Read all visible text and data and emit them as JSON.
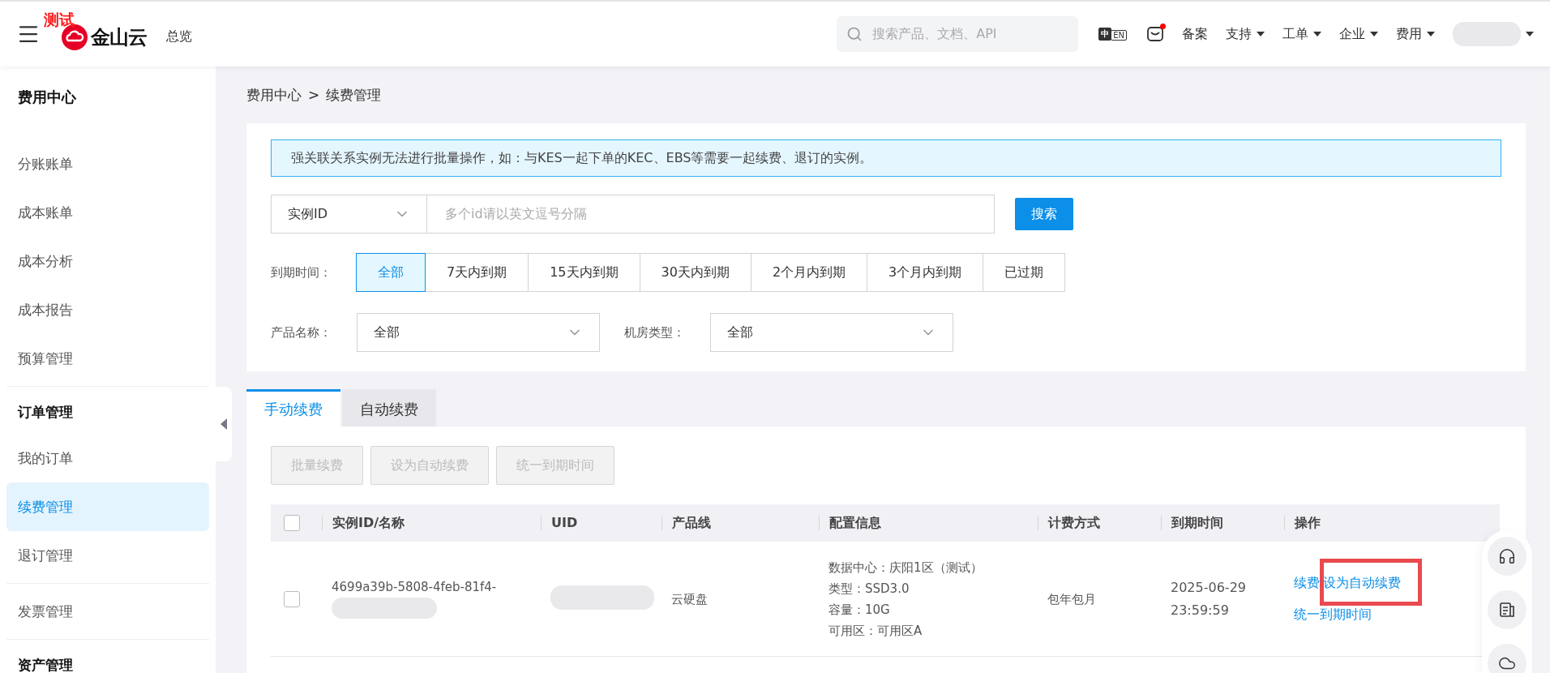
{
  "header": {
    "badge": "测试",
    "logo_text": "金山云",
    "overview": "总览",
    "search": {
      "placeholder": "搜索产品、文档、API"
    },
    "lang_switch": [
      {
        "label": "中",
        "selected": true
      },
      {
        "label": "EN",
        "selected": false
      }
    ],
    "mail": {
      "unread": true
    },
    "nav": [
      {
        "label": "备案",
        "dropdown": false
      },
      {
        "label": "支持",
        "dropdown": true
      },
      {
        "label": "工单",
        "dropdown": true
      },
      {
        "label": "企业",
        "dropdown": true
      },
      {
        "label": "费用",
        "dropdown": true
      }
    ]
  },
  "sidebar": {
    "title": "费用中心",
    "groups": [
      {
        "items": [
          {
            "label": "分账账单",
            "selected": false
          },
          {
            "label": "成本账单",
            "selected": false
          },
          {
            "label": "成本分析",
            "selected": false
          },
          {
            "label": "成本报告",
            "selected": false
          },
          {
            "label": "预算管理",
            "selected": false
          }
        ]
      },
      {
        "heading": "订单管理",
        "items": [
          {
            "label": "我的订单",
            "selected": false
          },
          {
            "label": "续费管理",
            "selected": true
          },
          {
            "label": "退订管理",
            "selected": false
          }
        ]
      },
      {
        "items": [
          {
            "label": "发票管理",
            "selected": false
          }
        ]
      },
      {
        "heading": "资产管理"
      }
    ]
  },
  "breadcrumb": {
    "items": [
      "费用中心",
      "续费管理"
    ],
    "separator": ">"
  },
  "notice": "强关联关系实例无法进行批量操作，如：与KES一起下单的KEC、EBS等需要一起续费、退订的实例。",
  "search": {
    "field": "实例ID",
    "placeholder": "多个id请以英文逗号分隔",
    "button": "搜索"
  },
  "expiry_filter": {
    "label": "到期时间：",
    "options": [
      {
        "label": "全部",
        "selected": true
      },
      {
        "label": "7天内到期",
        "selected": false
      },
      {
        "label": "15天内到期",
        "selected": false
      },
      {
        "label": "30天内到期",
        "selected": false
      },
      {
        "label": "2个月内到期",
        "selected": false
      },
      {
        "label": "3个月内到期",
        "selected": false
      },
      {
        "label": "已过期",
        "selected": false
      }
    ]
  },
  "selects": [
    {
      "label": "产品名称：",
      "value": "全部"
    },
    {
      "label": "机房类型：",
      "value": "全部"
    }
  ],
  "tabs": [
    {
      "label": "手动续费",
      "selected": true
    },
    {
      "label": "自动续费",
      "selected": false
    }
  ],
  "actions": [
    {
      "label": "批量续费",
      "disabled": true
    },
    {
      "label": "设为自动续费",
      "disabled": true
    },
    {
      "label": "统一到期时间",
      "disabled": true
    }
  ],
  "table": {
    "all_checked": false,
    "columns": [
      "实例ID/名称",
      "UID",
      "产品线",
      "配置信息",
      "计费方式",
      "到期时间",
      "操作"
    ],
    "rows": [
      {
        "checked": false,
        "instance_id": "4699a39b-5808-4feb-81f4-",
        "product": "云硬盘",
        "config": [
          "数据中心：庆阳1区（测试）",
          "类型：SSD3.0",
          "容量：10G",
          "可用区：可用区A"
        ],
        "billing": "包年包月",
        "expiry": [
          "2025-06-29",
          "23:59:59"
        ],
        "operations": [
          {
            "label": "续费",
            "highlighted": false
          },
          {
            "label": "设为自动续费",
            "highlighted": true
          },
          {
            "label": "统一到期时间",
            "highlighted": false
          }
        ]
      }
    ]
  }
}
